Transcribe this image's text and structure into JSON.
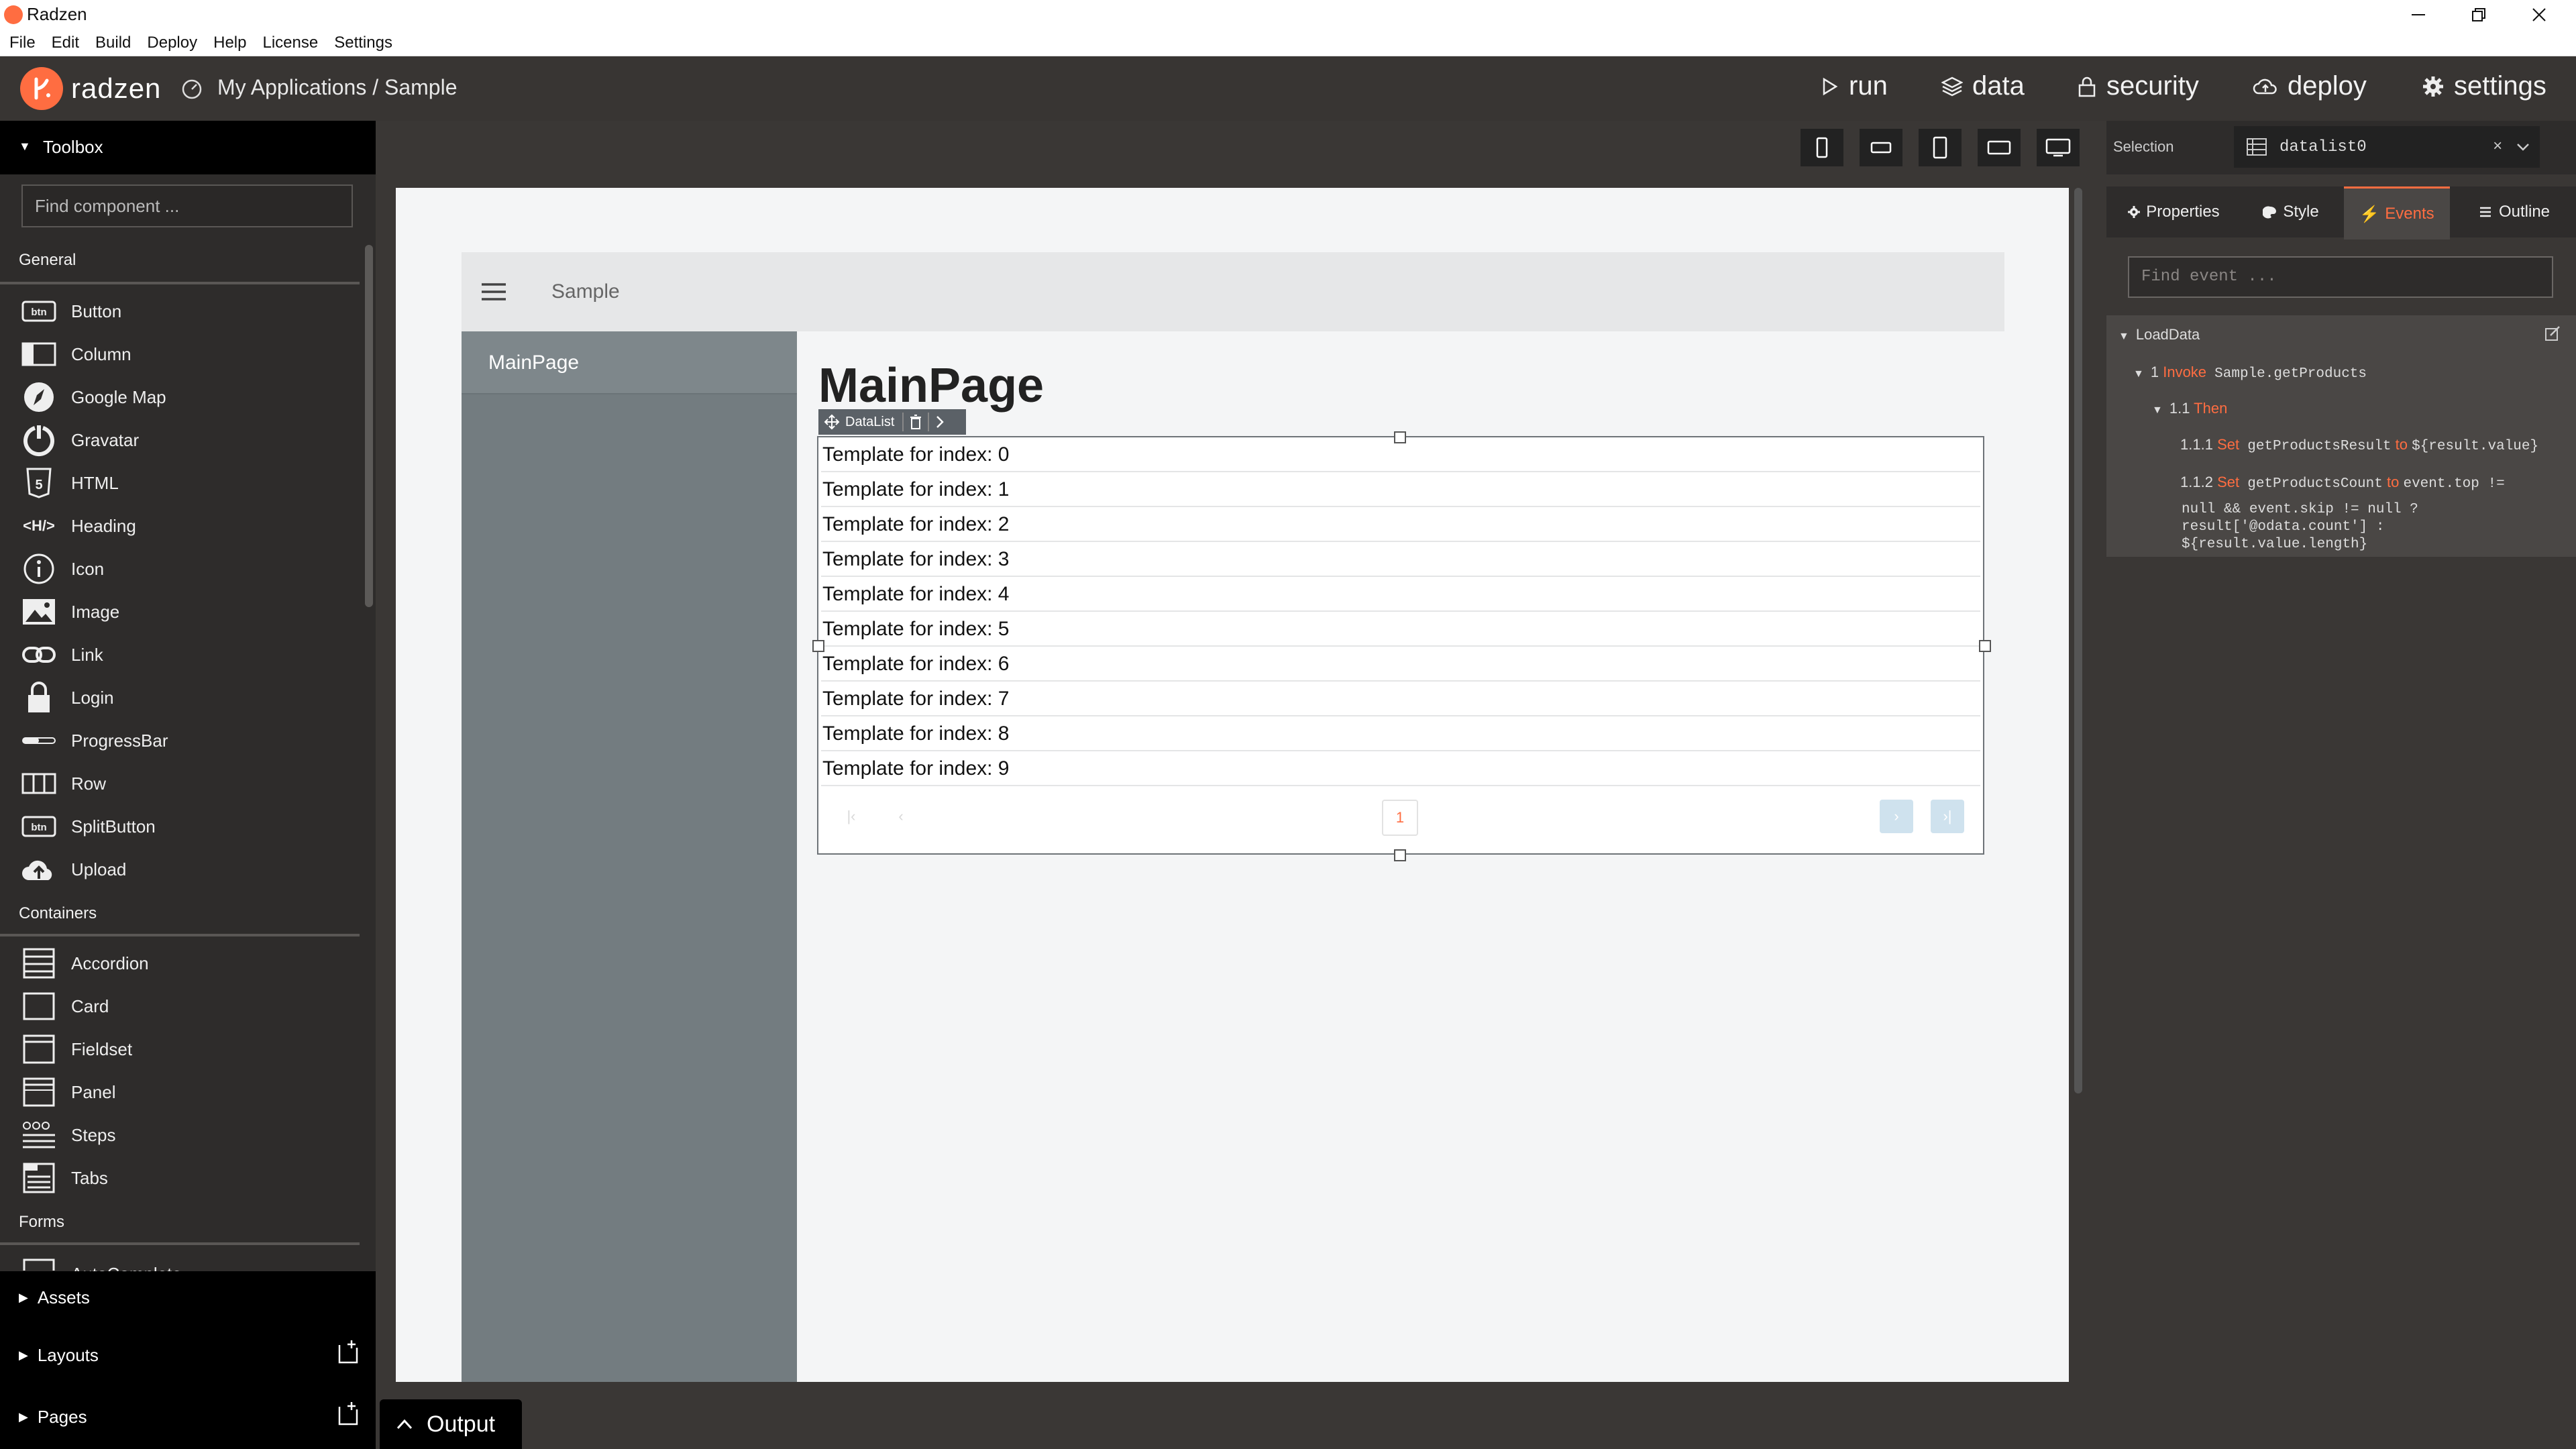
{
  "window": {
    "title": "Radzen"
  },
  "menu": [
    "File",
    "Edit",
    "Build",
    "Deploy",
    "Help",
    "License",
    "Settings"
  ],
  "header": {
    "brand": "radzen",
    "breadcrumb": "My Applications / Sample",
    "nav": {
      "run": "run",
      "data": "data",
      "security": "security",
      "deploy": "deploy",
      "settings": "settings"
    }
  },
  "toolbox": {
    "title": "Toolbox",
    "search_placeholder": "Find component ...",
    "sections": {
      "general": "General",
      "containers": "Containers",
      "forms": "Forms"
    },
    "general_items": [
      "Button",
      "Column",
      "Google Map",
      "Gravatar",
      "HTML",
      "Heading",
      "Icon",
      "Image",
      "Link",
      "Login",
      "ProgressBar",
      "Row",
      "SplitButton",
      "Upload"
    ],
    "container_items": [
      "Accordion",
      "Card",
      "Fieldset",
      "Panel",
      "Steps",
      "Tabs"
    ],
    "forms_partial": "AutoComplete",
    "assets": "Assets",
    "layouts": "Layouts",
    "pages": "Pages"
  },
  "canvas": {
    "page_header_title": "Sample",
    "nav_item": "MainPage",
    "page_title": "MainPage",
    "datalist_label": "DataList",
    "rows": [
      "Template for index: 0",
      "Template for index: 1",
      "Template for index: 2",
      "Template for index: 3",
      "Template for index: 4",
      "Template for index: 5",
      "Template for index: 6",
      "Template for index: 7",
      "Template for index: 8",
      "Template for index: 9"
    ],
    "pager_current": "1"
  },
  "output": {
    "label": "Output"
  },
  "right_panel": {
    "selection_label": "Selection",
    "selection_value": "datalist0",
    "tabs": {
      "properties": "Properties",
      "style": "Style",
      "events": "Events",
      "outline": "Outline"
    },
    "find_event_placeholder": "Find event ...",
    "event": {
      "name": "LoadData",
      "step1_num": "1",
      "step1_kw": "Invoke",
      "step1_target": "Sample.getProducts",
      "then_num": "1.1",
      "then_kw": "Then",
      "s111_num": "1.1.1",
      "s111_kw": "Set",
      "s111_name": "getProductsResult",
      "s111_to": "to",
      "s111_value": "${result.value}",
      "s112_num": "1.1.2",
      "s112_kw": "Set",
      "s112_name": "getProductsCount",
      "s112_to": "to",
      "s112_value1": "event.top !=",
      "s112_value2": "null && event.skip != null ?",
      "s112_value3": "result['@odata.count'] :",
      "s112_value4": "${result.value.length}"
    }
  },
  "colors": {
    "accent": "#ff6d41",
    "header_bg": "#383533",
    "sidebar_bg": "#737c80"
  }
}
